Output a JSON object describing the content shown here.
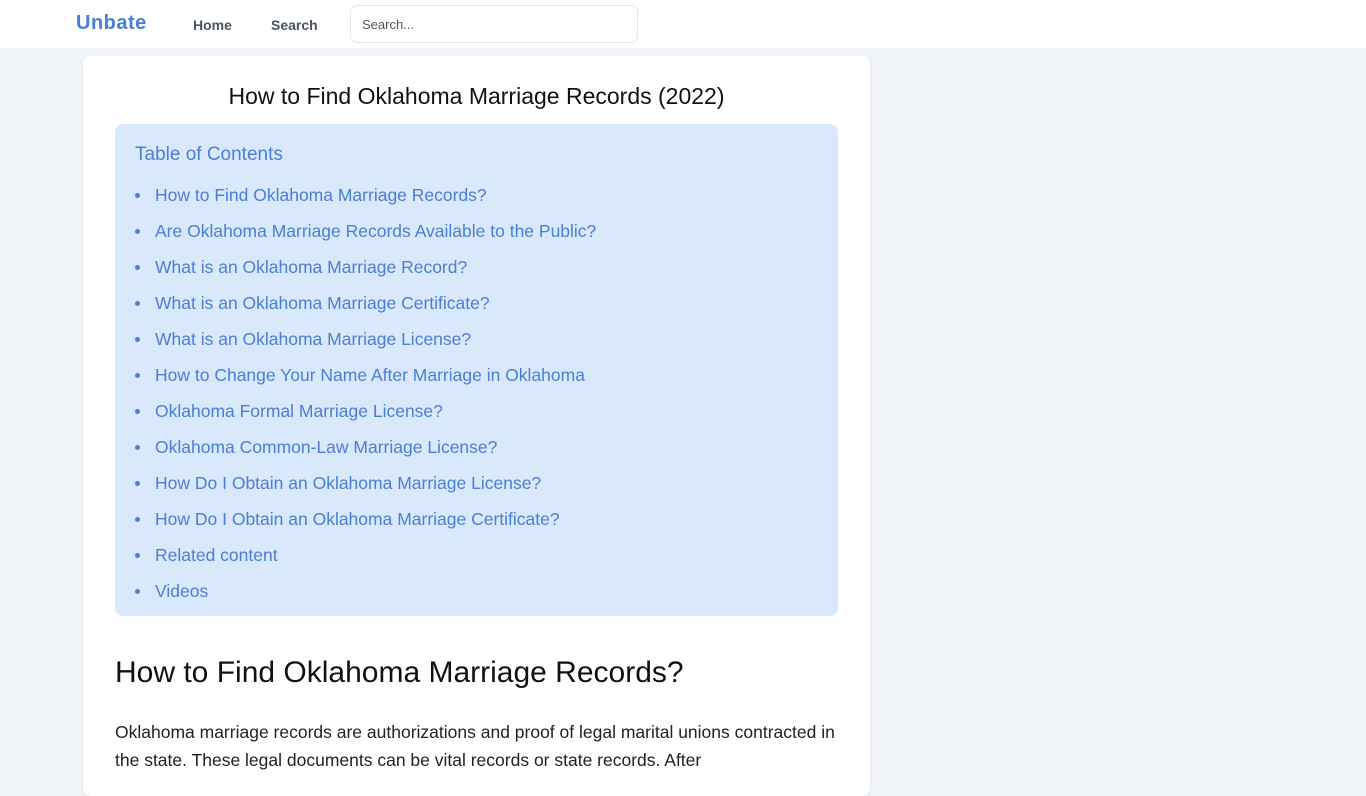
{
  "header": {
    "brand": "Unbate",
    "nav": [
      {
        "label": "Home"
      },
      {
        "label": "Search"
      }
    ],
    "search": {
      "placeholder": "Search...",
      "value": ""
    }
  },
  "article": {
    "title": "How to Find Oklahoma Marriage Records (2022)",
    "toc": {
      "heading": "Table of Contents",
      "items": [
        {
          "label": "How to Find Oklahoma Marriage Records?"
        },
        {
          "label": "Are Oklahoma Marriage Records Available to the Public?"
        },
        {
          "label": "What is an Oklahoma Marriage Record?"
        },
        {
          "label": "What is an Oklahoma Marriage Certificate?"
        },
        {
          "label": "What is an Oklahoma Marriage License?"
        },
        {
          "label": "How to Change Your Name After Marriage in Oklahoma"
        },
        {
          "label": "Oklahoma Formal Marriage License?"
        },
        {
          "label": "Oklahoma Common-Law Marriage License?"
        },
        {
          "label": "How Do I Obtain an Oklahoma Marriage License?"
        },
        {
          "label": "How Do I Obtain an Oklahoma Marriage Certificate?"
        },
        {
          "label": "Related content"
        },
        {
          "label": "Videos"
        }
      ]
    },
    "section": {
      "heading": "How to Find Oklahoma Marriage Records?",
      "body": "Oklahoma marriage records are authorizations and proof of legal marital unions contracted in the state. These legal documents can be vital records or state records. After"
    }
  },
  "colors": {
    "accent": "#4a7fd6",
    "toc_background": "#dae8fc",
    "page_background": "#f0f3f8"
  }
}
